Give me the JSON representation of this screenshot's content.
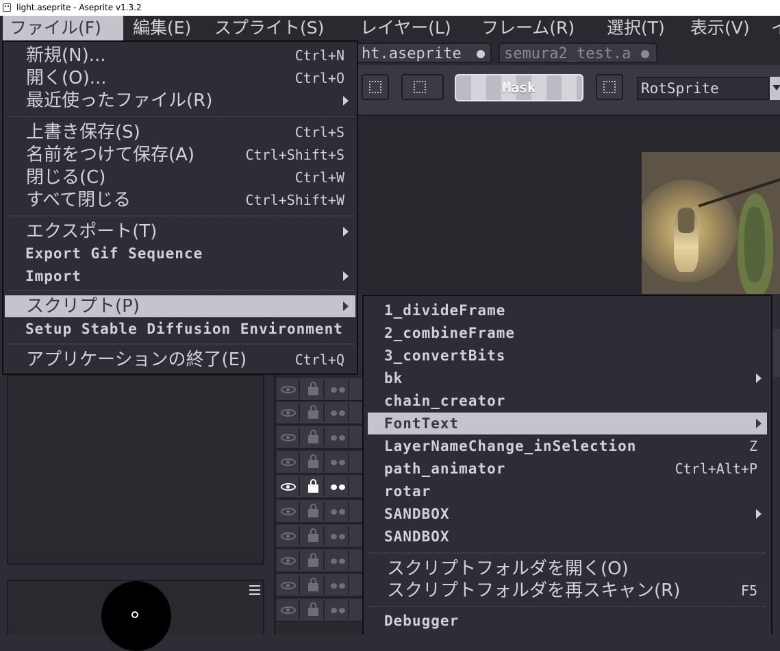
{
  "window": {
    "title": "light.aseprite - Aseprite v1.3.2"
  },
  "menubar": [
    "ファイル(F)",
    "編集(E)",
    "スプライト(S)",
    "レイヤー(L)",
    "フレーム(R)",
    "選択(T)",
    "表示(V)",
    "イ"
  ],
  "tabs": [
    {
      "label": "ht.aseprite"
    },
    {
      "label": "semura2_test.a"
    }
  ],
  "toolbar": {
    "mask_label": "Mask",
    "rotation_algorithm": "RotSprite"
  },
  "file_menu": {
    "items": [
      {
        "label": "新規(N)...",
        "shortcut": "Ctrl+N"
      },
      {
        "label": "開く(O)...",
        "shortcut": "Ctrl+O"
      },
      {
        "label": "最近使ったファイル(R)",
        "shortcut": ""
      },
      {
        "label": "上書き保存(S)",
        "shortcut": "Ctrl+S"
      },
      {
        "label": "名前をつけて保存(A)",
        "shortcut": "Ctrl+Shift+S"
      },
      {
        "label": "閉じる(C)",
        "shortcut": "Ctrl+W"
      },
      {
        "label": "すべて閉じる",
        "shortcut": "Ctrl+Shift+W"
      },
      {
        "label": "エクスポート(T)",
        "shortcut": ""
      },
      {
        "label": "Export Gif Sequence",
        "shortcut": ""
      },
      {
        "label": "Import",
        "shortcut": ""
      },
      {
        "label": "スクリプト(P)",
        "shortcut": ""
      },
      {
        "label": "Setup Stable Diffusion Environment",
        "shortcut": ""
      },
      {
        "label": "アプリケーションの終了(E)",
        "shortcut": "Ctrl+Q"
      }
    ]
  },
  "scripts_menu": {
    "items": [
      {
        "label": "1_divideFrame",
        "shortcut": ""
      },
      {
        "label": "2_combineFrame",
        "shortcut": ""
      },
      {
        "label": "3_convertBits",
        "shortcut": ""
      },
      {
        "label": "bk",
        "shortcut": ""
      },
      {
        "label": "chain_creator",
        "shortcut": ""
      },
      {
        "label": "FontText",
        "shortcut": ""
      },
      {
        "label": "LayerNameChange_inSelection",
        "shortcut": "Z"
      },
      {
        "label": "path_animator",
        "shortcut": "Ctrl+Alt+P"
      },
      {
        "label": "rotar",
        "shortcut": ""
      },
      {
        "label": "SANDBOX",
        "shortcut": ""
      },
      {
        "label": "SANDBOX",
        "shortcut": ""
      },
      {
        "label": "スクリプトフォルダを開く(O)",
        "shortcut": ""
      },
      {
        "label": "スクリプトフォルダを再スキャン(R)",
        "shortcut": "F5"
      },
      {
        "label": "Debugger",
        "shortcut": ""
      }
    ]
  },
  "colors": {
    "menu_bg": "#2e2c35",
    "highlight": "#c6c3cc",
    "text": "#d2d0d8"
  }
}
